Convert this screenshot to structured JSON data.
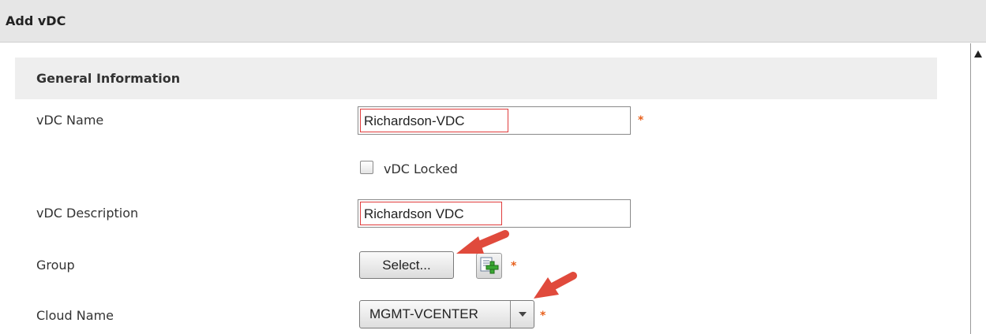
{
  "window": {
    "title": "Add vDC"
  },
  "section": {
    "title": "General Information"
  },
  "fields": {
    "vdc_name": {
      "label": "vDC Name",
      "value": "Richardson-VDC",
      "required": true
    },
    "vdc_locked": {
      "label": "vDC Locked",
      "checked": false
    },
    "vdc_description": {
      "label": "vDC Description",
      "value": "Richardson VDC"
    },
    "group": {
      "label": "Group",
      "button_label": "Select...",
      "required": true
    },
    "cloud_name": {
      "label": "Cloud Name",
      "selected": "MGMT-VCENTER",
      "required": true
    }
  },
  "required_marker": "*",
  "icons": {
    "add": "add-group-icon",
    "scroll_up": "scroll-up-arrow-icon",
    "dropdown": "chevron-down-icon",
    "annotation": "red-arrow-annotation"
  },
  "colors": {
    "required_marker": "#e8601c",
    "input_highlight": "#e03c3c",
    "annotation_arrow": "#e04a3c"
  }
}
